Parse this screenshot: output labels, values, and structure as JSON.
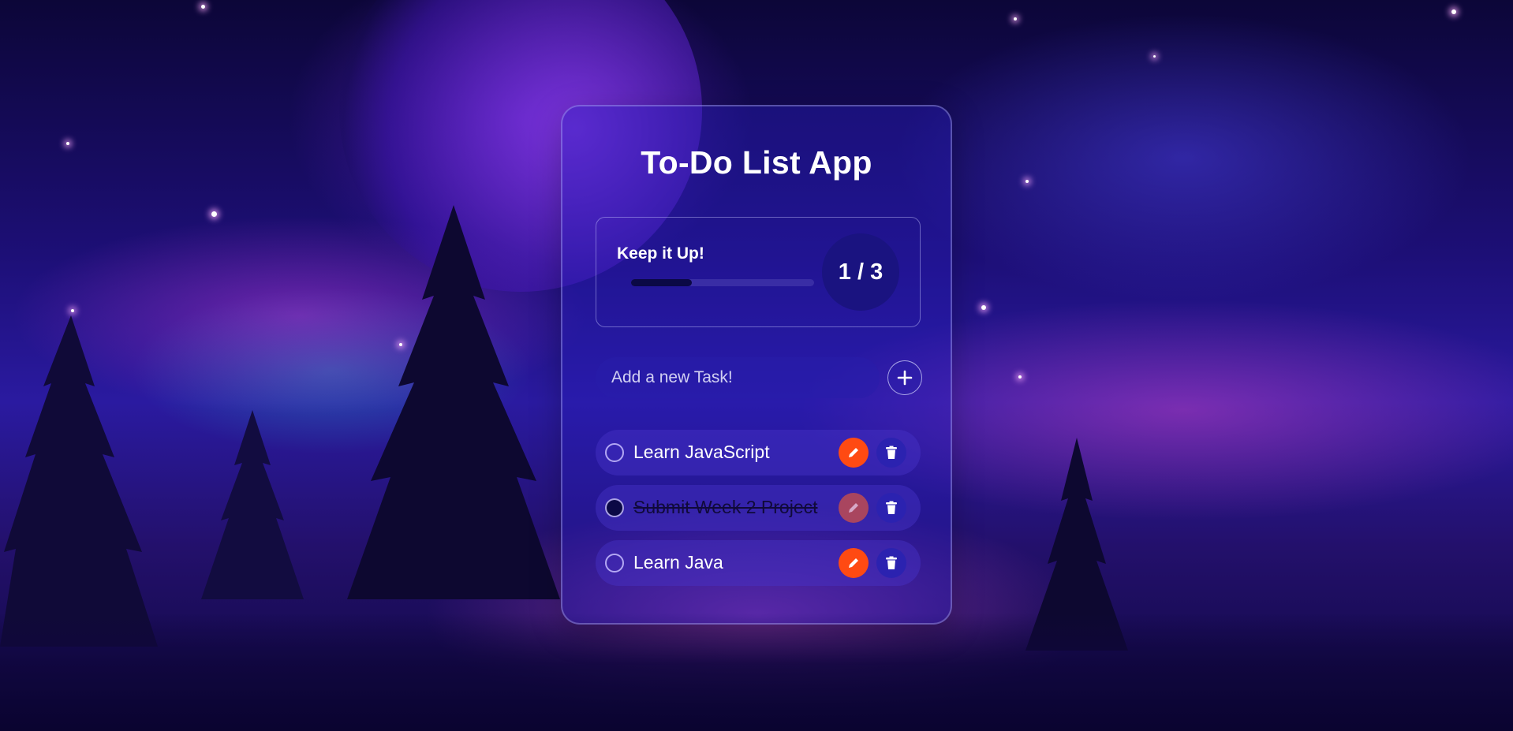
{
  "app": {
    "title": "To-Do List App"
  },
  "progress": {
    "label": "Keep it Up!",
    "completed": 1,
    "total": 3,
    "count_text": "1 / 3",
    "fraction": 0.333
  },
  "new_task": {
    "placeholder": "Add a new Task!",
    "value": "",
    "add_icon": "plus-icon"
  },
  "tasks": [
    {
      "text": "Learn JavaScript",
      "completed": false
    },
    {
      "text": "Submit Week 2 Project",
      "completed": true
    },
    {
      "text": "Learn Java",
      "completed": false
    }
  ],
  "icons": {
    "edit": "pencil-icon",
    "delete": "trash-icon"
  },
  "colors": {
    "edit_button": "#ff4a12",
    "edit_button_done": "#a9455f",
    "delete_button": "#2b22b0",
    "progress_fill": "#0b0945"
  }
}
